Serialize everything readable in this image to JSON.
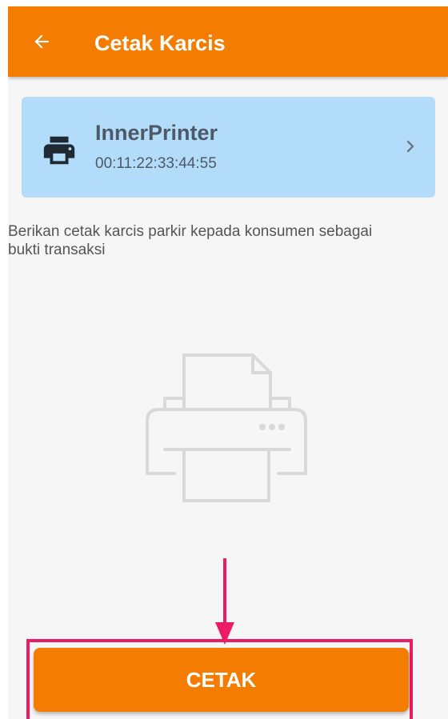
{
  "colors": {
    "app_bar": "#f47c00",
    "screen_background": "#f6f6f6",
    "printer_card_background": "#b3dcfb",
    "printer_text": "#4d5966",
    "button": "#f47c00",
    "highlight": "#ec1c64"
  },
  "app_bar": {
    "back_icon": "arrow-left-icon",
    "title": "Cetak Karcis"
  },
  "printer_card": {
    "icon": "printer-icon",
    "name": "InnerPrinter",
    "address": "00:11:22:33:44:55",
    "chevron_icon": "chevron-right-icon"
  },
  "instruction": {
    "text": "Berikan cetak karcis parkir kepada konsumen sebagai bukti transaksi"
  },
  "illustration": {
    "icon": "printer-outline-illustration"
  },
  "annotation": {
    "arrow_icon": "arrow-down-annotation",
    "highlight_color": "#ec1c64"
  },
  "footer": {
    "print_button_label": "CETAK"
  }
}
